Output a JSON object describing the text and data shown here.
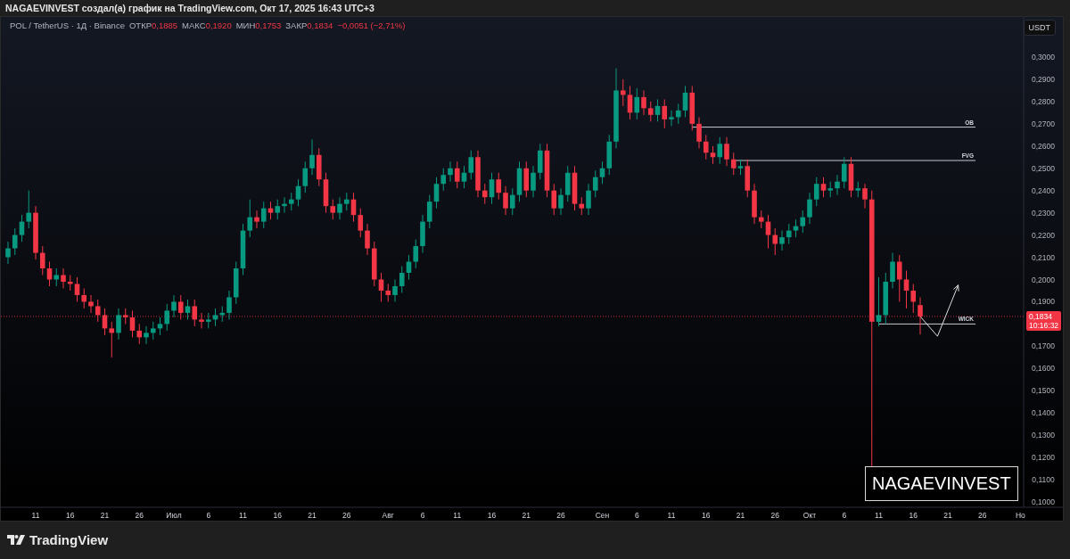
{
  "header": {
    "text": "NAGAEVINVEST создал(а) график на TradingView.com, Окт 17, 2025 16:43 UTC+3"
  },
  "legend": {
    "symbol": "POL / TetherUS · 1Д · Binance",
    "fields": [
      {
        "label": "ОТКР",
        "value": "0,1885"
      },
      {
        "label": "МАКС",
        "value": "0,1920"
      },
      {
        "label": "МИН",
        "value": "0,1753"
      },
      {
        "label": "ЗАКР",
        "value": "0,1834"
      }
    ],
    "change": "−0,0051 (−2,71%)"
  },
  "currency_button": "USDT",
  "price_axis": [
    "0,3000",
    "0,2900",
    "0,2800",
    "0,2700",
    "0,2600",
    "0,2500",
    "0,2400",
    "0,2300",
    "0,2200",
    "0,2100",
    "0,2000",
    "0,1900",
    "0,1700",
    "0,1600",
    "0,1500",
    "0,1400",
    "0,1300",
    "0,1200",
    "0,1100",
    "0,1000"
  ],
  "time_axis": [
    "11",
    "16",
    "21",
    "26",
    "Июл",
    "6",
    "11",
    "16",
    "21",
    "26",
    "Авг",
    "6",
    "11",
    "16",
    "21",
    "26",
    "Сен",
    "6",
    "11",
    "16",
    "21",
    "26",
    "Окт",
    "6",
    "11",
    "16",
    "21",
    "26",
    "Но"
  ],
  "level_labels": [
    "OB",
    "FVG",
    "WICK"
  ],
  "price_tag": {
    "price": "0,1834",
    "countdown": "10:16:32"
  },
  "author_label": "NAGAEVINVEST",
  "footer": {
    "logo_text": "TradingView"
  }
}
